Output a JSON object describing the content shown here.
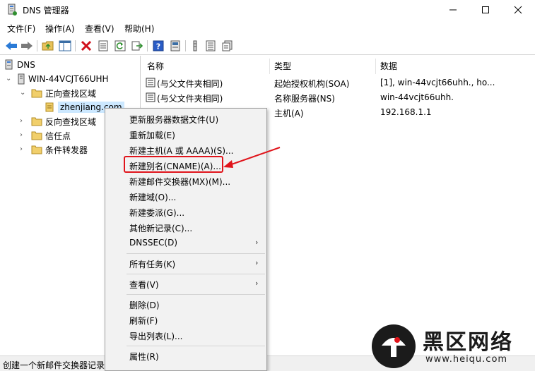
{
  "window": {
    "title": "DNS 管理器",
    "controls": {
      "minimize": "—",
      "maximize": "☐",
      "close": "✕"
    }
  },
  "menubar": [
    "文件(F)",
    "操作(A)",
    "查看(V)",
    "帮助(H)"
  ],
  "toolbar": {
    "icons": [
      "back-icon",
      "forward-icon",
      "up-folder-icon",
      "show-hide-tree-icon",
      "delete-icon",
      "properties-icon",
      "refresh-icon",
      "export-list-icon",
      "help-icon",
      "help-book-icon",
      "bar-icon",
      "list-icon",
      "records-icon"
    ]
  },
  "tree": {
    "root": "DNS",
    "server": "WIN-44VCJT66UHH",
    "forward_zones": "正向查找区域",
    "zone": "zhenjiang.com",
    "reverse_zones": "反向查找区域",
    "trust_points": "信任点",
    "conditional_forwarders": "条件转发器"
  },
  "list": {
    "columns": [
      "名称",
      "类型",
      "数据"
    ],
    "rows": [
      {
        "name": "(与父文件夹相同)",
        "type": "起始授权机构(SOA)",
        "data": "[1], win-44vcjt66uhh., ho..."
      },
      {
        "name": "(与父文件夹相同)",
        "type": "名称服务器(NS)",
        "data": "win-44vcjt66uhh."
      },
      {
        "name": "",
        "type": "主机(A)",
        "data": "192.168.1.1"
      }
    ]
  },
  "context_menu": {
    "items": [
      {
        "label": "更新服务器数据文件(U)"
      },
      {
        "label": "重新加载(E)"
      },
      {
        "label": "新建主机(A 或 AAAA)(S)..."
      },
      {
        "label": "新建别名(CNAME)(A)..."
      },
      {
        "label": "新建邮件交换器(MX)(M)..."
      },
      {
        "label": "新建域(O)..."
      },
      {
        "label": "新建委派(G)..."
      },
      {
        "label": "其他新记录(C)..."
      },
      {
        "label": "DNSSEC(D)"
      },
      {
        "label": "所有任务(K)"
      },
      {
        "label": "查看(V)"
      },
      {
        "label": "删除(D)"
      },
      {
        "label": "刷新(F)"
      },
      {
        "label": "导出列表(L)..."
      },
      {
        "label": "属性(R)"
      }
    ],
    "highlight_color": "#e0141b"
  },
  "statusbar": {
    "text": "创建一个新邮件交换器记录"
  },
  "watermark": {
    "text": "黑区网络",
    "url": "www.heiqu.com"
  }
}
